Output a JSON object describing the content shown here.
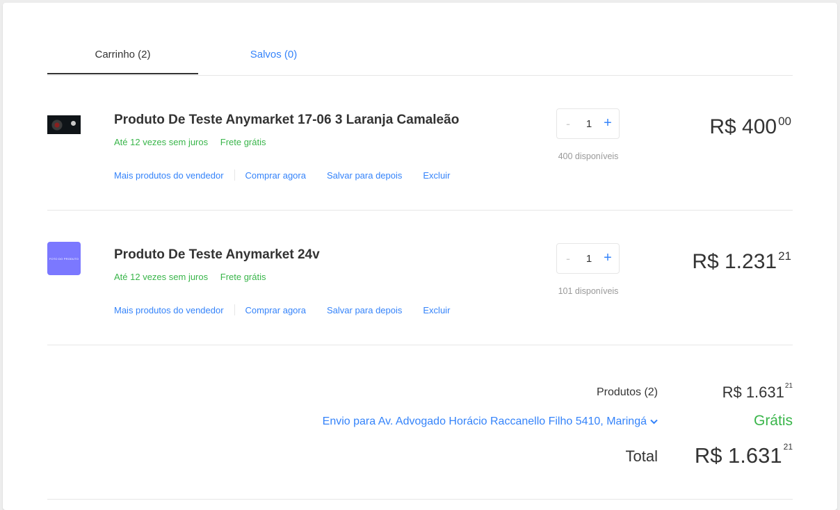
{
  "tabs": {
    "cart": "Carrinho (2)",
    "saved": "Salvos (0)"
  },
  "items": [
    {
      "title": "Produto De Teste Anymarket 17-06 3 Laranja Camaleão",
      "installments": "Até 12 vezes sem juros",
      "shipping": "Frete grátis",
      "actions": [
        "Mais produtos do vendedor",
        "Comprar agora",
        "Salvar para depois",
        "Excluir"
      ],
      "minus": "-",
      "quantity": "1",
      "plus": "+",
      "stock": "400 disponíveis",
      "price_main": "R$ 400",
      "price_cents": "00"
    },
    {
      "title": "Produto De Teste Anymarket 24v",
      "thumb_text": "FOTO DO PRODUTO",
      "installments": "Até 12 vezes sem juros",
      "shipping": "Frete grátis",
      "actions": [
        "Mais produtos do vendedor",
        "Comprar agora",
        "Salvar para depois",
        "Excluir"
      ],
      "minus": "-",
      "quantity": "1",
      "plus": "+",
      "stock": "101 disponíveis",
      "price_main": "R$ 1.231",
      "price_cents": "21"
    }
  ],
  "summary": {
    "products_label": "Produtos (2)",
    "products_price_main": "R$ 1.631",
    "products_price_cents": "21",
    "shipping_label": "Envio para Av. Advogado Horácio Raccanello Filho 5410, Maringá",
    "shipping_value": "Grátis",
    "total_label": "Total",
    "total_price_main": "R$ 1.631",
    "total_price_cents": "21"
  },
  "colors": {
    "accent": "#3483fa",
    "success": "#39b54a",
    "text": "#333333",
    "muted": "#999999",
    "thumb_placeholder": "#7b78ff"
  }
}
